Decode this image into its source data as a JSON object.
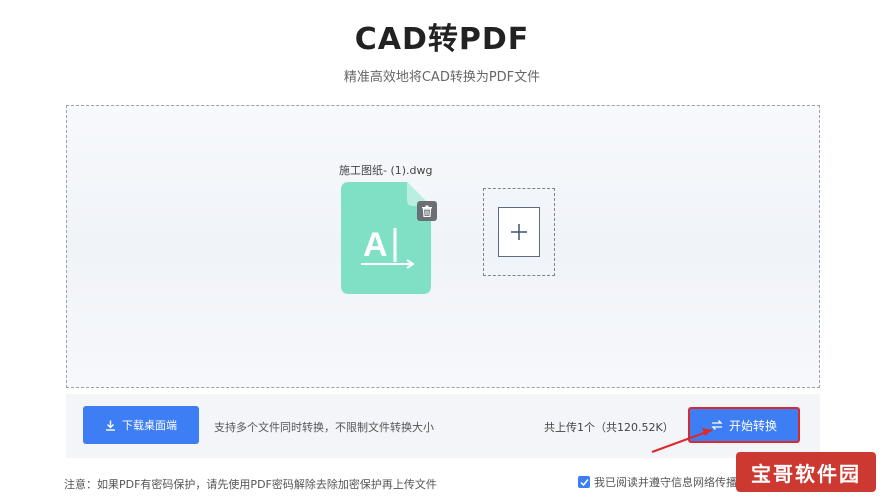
{
  "header": {
    "title": "CAD转PDF",
    "subtitle": "精准高效地将CAD转换为PDF文件"
  },
  "upload": {
    "file": {
      "name": "施工图纸- (1).dwg",
      "icon": "cad-file-icon",
      "icon_color": "#7fe0c6"
    },
    "delete_icon": "trash-icon",
    "add_icon": "plus-icon"
  },
  "actions": {
    "download_label": "下载桌面端",
    "support_text": "支持多个文件同时转换，不限制文件转换大小",
    "upload_info": "共上传1个（共120.52K）",
    "start_label": "开始转换",
    "accent_color": "#3d7ef5",
    "highlight_color": "#d92b2b"
  },
  "footer": {
    "note": "注意：如果PDF有密码保护，请先使用PDF密码解除去除加密保护再上传文件",
    "agree_label": "我已阅读并遵守信息网络传播",
    "agree_checked": true
  },
  "watermark": {
    "text": "宝哥软件园"
  }
}
